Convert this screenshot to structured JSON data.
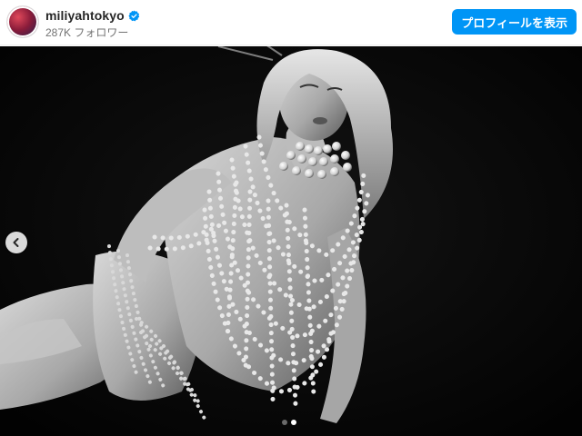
{
  "header": {
    "username": "miliyahtokyo",
    "followers": "287K フォロワー",
    "profile_button_label": "プロフィールを表示",
    "verified_icon": "verified-badge-icon"
  },
  "post": {
    "image_description_icon": "photo",
    "carousel": {
      "total_slides": 2,
      "active_slide": 2
    },
    "prev_icon": "chevron-left-icon"
  },
  "colors": {
    "accent": "#0095f6",
    "username": "#262626",
    "secondary_text": "#737373",
    "photo_background": "#060606"
  }
}
